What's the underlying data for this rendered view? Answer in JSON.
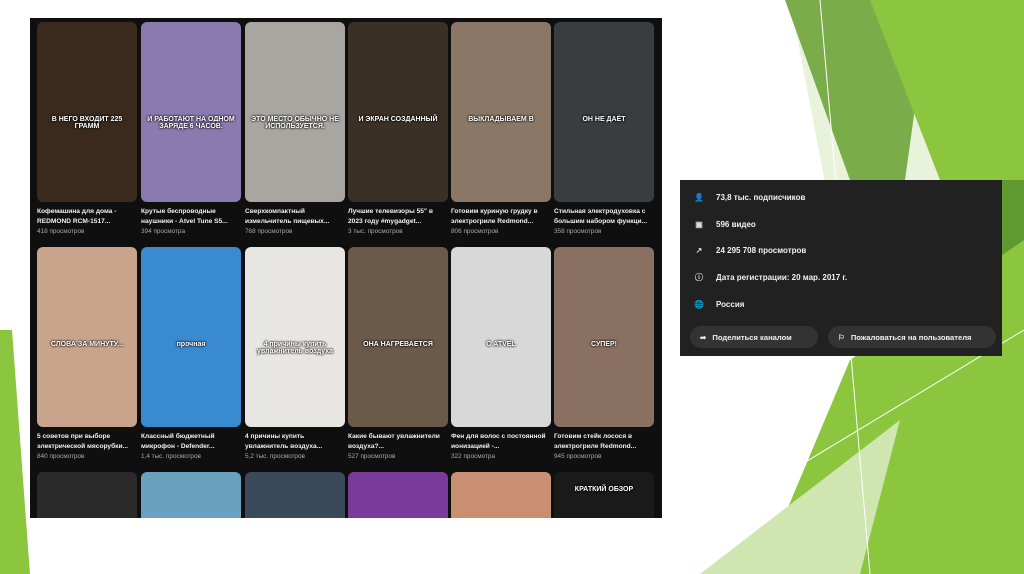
{
  "videos": [
    {
      "title": "Кофемашина для дома - REDMOND RCM-1517...",
      "views": "418 просмотров",
      "caption": "В НЕГО ВХОДИТ 225 ГРАММ",
      "bg": "#3a2a1e"
    },
    {
      "title": "Крутые беспроводные наушники - Atvel Tune S5...",
      "views": "394 просмотра",
      "caption": "И РАБОТАЮТ НА ОДНОМ ЗАРЯДЕ 6 ЧАСОВ.",
      "bg": "#8a7ab0"
    },
    {
      "title": "Сверхкомпактный измельчитель пищевых...",
      "views": "768 просмотров",
      "caption": "ЭТО МЕСТО ОБЫЧНО НЕ ИСПОЛЬЗУЕТСЯ.",
      "bg": "#a9a6a2"
    },
    {
      "title": "Лучшие телевизоры 55\" в 2023 году #mygadget...",
      "views": "3 тыс. просмотров",
      "caption": "И ЭКРАН СОЗДАННЫЙ",
      "bg": "#3b3026"
    },
    {
      "title": "Готовим куриную грудку в электрогриле Redmond...",
      "views": "806 просмотров",
      "caption": "ВЫКЛАДЫВАЕМ В",
      "bg": "#8a7766"
    },
    {
      "title": "Стильная электродуховка с большим набором функци...",
      "views": "358 просмотров",
      "caption": "ОН НЕ ДАЁТ",
      "bg": "#3a3d40"
    },
    {
      "title": "5 советов при выборе электрической мясорубки...",
      "views": "840 просмотров",
      "caption": "СЛОВА ЗА МИНУТУ...",
      "bg": "#c9a48c"
    },
    {
      "title": "Классный бюджетный микрофон - Defender...",
      "views": "1,4 тыс. просмотров",
      "caption": "прочная",
      "bg": "#3a8ad0"
    },
    {
      "title": "4 причины купить увлажнитель воздуха...",
      "views": "5,2 тыс. просмотров",
      "caption": "4 причины купить увлажнитель воздуха",
      "bg": "#e8e6e2"
    },
    {
      "title": "Какие бывают увлажнители воздуха?...",
      "views": "527 просмотров",
      "caption": "ОНА НАГРЕВАЕТСЯ",
      "bg": "#6b5a4a"
    },
    {
      "title": "Фен для волос с постоянной ионизацией -...",
      "views": "322 просмотра",
      "caption": "С ATVEL",
      "bg": "#d8d8d8"
    },
    {
      "title": "Готовим стейк лосося в электрогриле Redmond...",
      "views": "945 просмотров",
      "caption": "СУПЕР!",
      "bg": "#8a7060"
    }
  ],
  "partial_row": [
    {
      "bg": "#2a2a2a",
      "caption": ""
    },
    {
      "bg": "#6aa0c0",
      "caption": ""
    },
    {
      "bg": "#3a4a5a",
      "caption": ""
    },
    {
      "bg": "#7a3a9a",
      "caption": ""
    },
    {
      "bg": "#c89070",
      "caption": ""
    },
    {
      "bg": "#1a1a1a",
      "caption": "КРАТКИЙ ОБЗОР"
    }
  ],
  "about": {
    "subscribers": "73,8 тыс. подписчиков",
    "videos": "596 видео",
    "views": "24 295 708 просмотров",
    "joined": "Дата регистрации: 20 мар. 2017 г.",
    "country": "Россия",
    "share_label": "Поделиться каналом",
    "report_label": "Пожаловаться на пользователя"
  },
  "colors": {
    "green_dark": "#4e8c2a",
    "green_light": "#8cc63f",
    "panel": "#212121"
  }
}
